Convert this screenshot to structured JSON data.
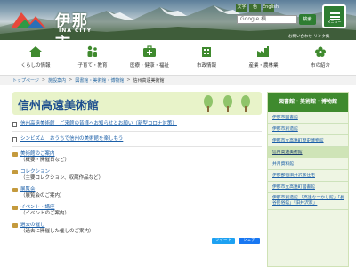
{
  "header": {
    "logo_text": "伊那市",
    "logo_sub": "INA CITY",
    "lang_buttons": [
      "文字",
      "色",
      "English"
    ],
    "search_placeholder": "Google 検",
    "search_button": "検索",
    "menu_label": "メニュー",
    "sub_links": "お問い合わせ  リンク集"
  },
  "nav": {
    "items": [
      {
        "label": "くらしの情報",
        "icon": "house-icon"
      },
      {
        "label": "子育て・教育",
        "icon": "family-icon"
      },
      {
        "label": "医療・健康・福祉",
        "icon": "medical-icon"
      },
      {
        "label": "市政情報",
        "icon": "building-icon"
      },
      {
        "label": "産業・農林業",
        "icon": "industry-icon"
      },
      {
        "label": "市の紹介",
        "icon": "flower-icon"
      }
    ]
  },
  "breadcrumb": {
    "items": [
      "トップページ",
      "施設案内",
      "図書館・美術館・博物館"
    ],
    "current": "信州高遠美術館"
  },
  "page": {
    "title": "信州高遠美術館"
  },
  "content": {
    "rows": [
      {
        "icon": "page-icon",
        "link": "信州高遠美術館　ご来館の皆様へお知らせとお願い（新型コロナ対策）",
        "desc": ""
      },
      {
        "icon": "page-icon",
        "link": "シンビズム　おうちで信州の美術館を楽しもう",
        "desc": ""
      },
      {
        "icon": "folder-icon",
        "link": "美術館のご案内",
        "desc": "（概要・開催日など）"
      },
      {
        "icon": "folder-icon",
        "link": "コレクション",
        "desc": "（主要コレクション、収蔵作品など）"
      },
      {
        "icon": "folder-icon",
        "link": "展覧会",
        "desc": "（展覧会のご案内）"
      },
      {
        "icon": "folder-icon",
        "link": "イベント・講座",
        "desc": "（イベントのご案内）"
      },
      {
        "icon": "folder-icon",
        "link": "過去の催し",
        "desc": "（過去に開催した催しのご案内）"
      }
    ],
    "share_twitter": "ツイート",
    "share_facebook": "シェア"
  },
  "sidebar": {
    "heading": "図書館・美術館・博物館",
    "items": [
      {
        "label": "伊那市図書館",
        "active": false,
        "tall": false
      },
      {
        "label": "伊那市創造館",
        "active": false,
        "tall": false
      },
      {
        "label": "伊那市立高遠町歴史博物館",
        "active": false,
        "tall": false
      },
      {
        "label": "信州高遠美術館",
        "active": true,
        "tall": false
      },
      {
        "label": "井月資料館",
        "active": false,
        "tall": false
      },
      {
        "label": "伊那部宿旧井沢家住宅",
        "active": false,
        "tall": false
      },
      {
        "label": "伊那市立高遠町図書館",
        "active": false,
        "tall": false
      },
      {
        "label": "伊那市創造館 「高遠なつかし館」「長谷民俗館」「旧井沢家」",
        "active": false,
        "tall": true
      }
    ]
  },
  "colors": {
    "accent_green": "#3f8a2e",
    "title_blue": "#1e4f8f",
    "link_blue": "#1b5fa8",
    "title_bg": "#e8f3c9"
  }
}
